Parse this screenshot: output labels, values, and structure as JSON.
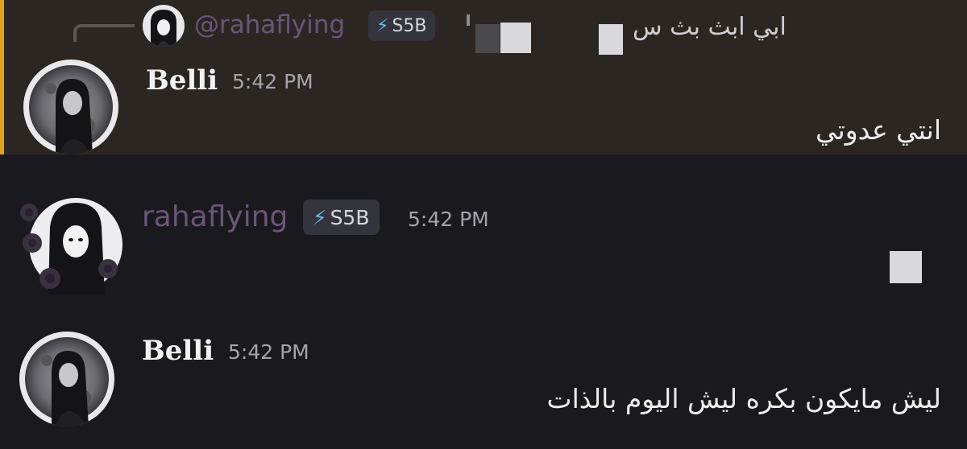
{
  "reply": {
    "name": "@rahaflying",
    "badge_icon": "⚡",
    "badge_label": "S5B",
    "text": "ابي ابث بث س"
  },
  "messages": [
    {
      "author": "Belli",
      "time": "5:42 PM",
      "text": "انتي عدوتي"
    },
    {
      "author": "rahaflying",
      "badge_icon": "⚡",
      "badge_label": "S5B",
      "time": "5:42 PM",
      "text": ""
    },
    {
      "author": "Belli",
      "time": "5:42 PM",
      "text": "ليش مايكون بكره ليش اليوم بالذات"
    }
  ],
  "colors": {
    "background": "#1a1a1e",
    "highlight_background": "#2b2622",
    "highlight_bar": "#e0a21a",
    "role_color": "#6b5579",
    "badge_bolt": "#6fb8e0"
  },
  "icons": {
    "reply": "reply-spine-icon",
    "badge": "lightning-bolt-icon",
    "avatar_belli": "moon-portrait-avatar",
    "avatar_raha": "anime-roses-avatar"
  }
}
